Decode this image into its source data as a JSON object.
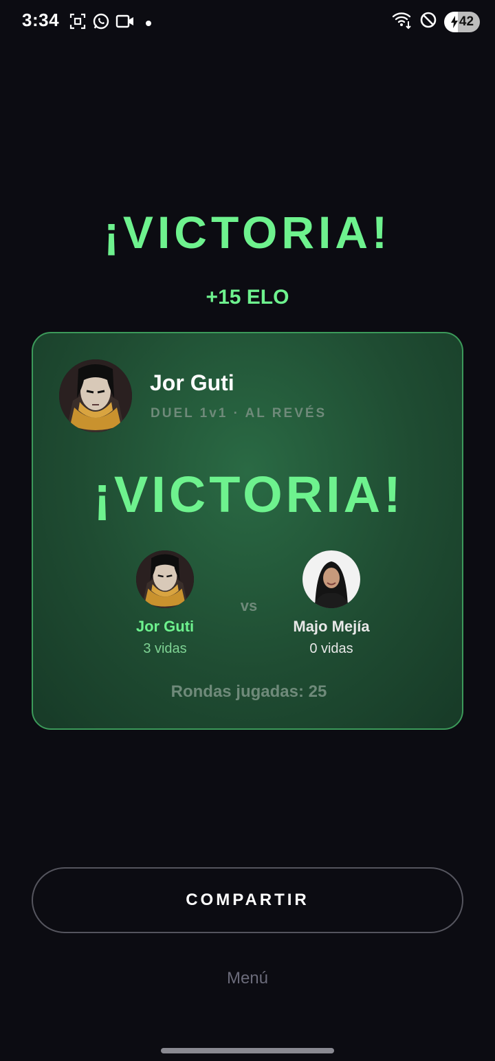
{
  "status_bar": {
    "time": "3:34",
    "battery": "42",
    "left_icons": [
      "screenshot-icon",
      "whatsapp-icon",
      "video-icon",
      "dot-icon"
    ],
    "right_icons": [
      "wifi-icon",
      "dnd-icon",
      "battery-icon"
    ]
  },
  "result": {
    "headline": "¡VICTORIA!",
    "elo_change": "+15 ELO"
  },
  "card": {
    "username": "Jor Guti",
    "mode": "DUEL 1v1 · AL REVÉS",
    "victory_text": "¡VICTORIA!",
    "player1": {
      "name": "Jor Guti",
      "lives": "3 vidas"
    },
    "vs": "vs",
    "player2": {
      "name": "Majo Mejía",
      "lives": "0 vidas"
    },
    "rounds": "Rondas jugadas: 25"
  },
  "actions": {
    "share_label": "COMPARTIR",
    "menu_label": "Menú"
  },
  "colors": {
    "accent_green": "#6ef28e",
    "background": "#0c0c12",
    "card_border": "#3c9a5a"
  }
}
